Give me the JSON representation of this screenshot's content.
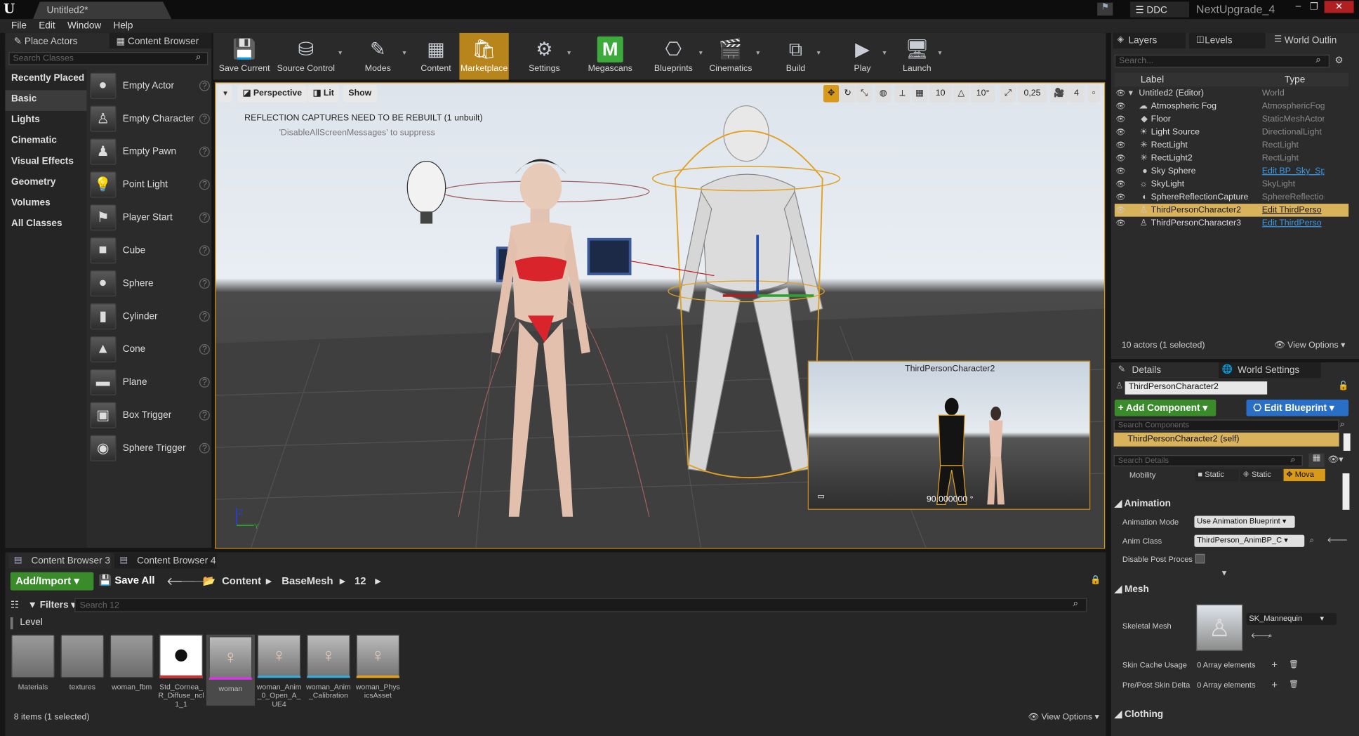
{
  "window": {
    "doc_tab": "Untitled2*",
    "ddc_label": "DDC",
    "project": "NextUpgrade_4"
  },
  "menu": [
    "File",
    "Edit",
    "Window",
    "Help"
  ],
  "place_actors": {
    "tab_label": "Place Actors",
    "content_browser_tab": "Content Browser",
    "search_placeholder": "Search Classes",
    "categories": [
      "Recently Placed",
      "Basic",
      "Lights",
      "Cinematic",
      "Visual Effects",
      "Geometry",
      "Volumes",
      "All Classes"
    ],
    "actors": [
      "Empty Actor",
      "Empty Character",
      "Empty Pawn",
      "Point Light",
      "Player Start",
      "Cube",
      "Sphere",
      "Cylinder",
      "Cone",
      "Plane",
      "Box Trigger",
      "Sphere Trigger"
    ]
  },
  "toolbar": {
    "buttons": [
      "Save Current",
      "Source Control",
      "Modes",
      "Content",
      "Marketplace",
      "Settings",
      "Megascans",
      "Blueprints",
      "Cinematics",
      "Build",
      "Play",
      "Launch"
    ],
    "active": "Marketplace"
  },
  "viewport": {
    "perspective": "Perspective",
    "lit": "Lit",
    "show": "Show",
    "msg_main": "REFLECTION CAPTURES NEED TO BE REBUILT (1 unbuilt)",
    "msg_sub": "'DisableAllScreenMessages' to suppress",
    "grid_snap": "10",
    "rot_snap": "10°",
    "scale_snap": "0,25",
    "cam_speed": "4",
    "pip_title": "ThirdPersonCharacter2",
    "pip_angle": "90.000000 °",
    "axis_z": "Z",
    "axis_y": "Y"
  },
  "content_browser": {
    "tab1": "Content Browser 3",
    "tab2": "Content Browser 4",
    "add_import": "Add/Import",
    "save_all": "Save All",
    "breadcrumbs": [
      "Content",
      "BaseMesh",
      "12"
    ],
    "filters": "Filters",
    "search_placeholder": "Search 12",
    "level_chip": "Level",
    "assets": [
      {
        "label": "Materials",
        "kind": "folder"
      },
      {
        "label": "textures",
        "kind": "folder"
      },
      {
        "label": "woman_fbm",
        "kind": "folder"
      },
      {
        "label": "Std_Cornea_R_Diffuse_ncl1_1",
        "kind": "texture"
      },
      {
        "label": "woman",
        "kind": "mesh"
      },
      {
        "label": "woman_Anim_0_Open_A_UE4",
        "kind": "anim"
      },
      {
        "label": "woman_Anim_Calibration",
        "kind": "anim"
      },
      {
        "label": "woman_PhysicsAsset",
        "kind": "physics"
      }
    ],
    "status": "8 items (1 selected)",
    "view_options": "View Options"
  },
  "outliner": {
    "tabs": [
      "Layers",
      "Levels",
      "World Outlin"
    ],
    "search_placeholder": "Search...",
    "col_label": "Label",
    "col_type": "Type",
    "rows": [
      {
        "label": "Untitled2 (Editor)",
        "type": "World",
        "link": false,
        "selected": false
      },
      {
        "label": "Atmospheric Fog",
        "type": "AtmosphericFog",
        "link": false,
        "selected": false
      },
      {
        "label": "Floor",
        "type": "StaticMeshActor",
        "link": false,
        "selected": false
      },
      {
        "label": "Light Source",
        "type": "DirectionalLight",
        "link": false,
        "selected": false
      },
      {
        "label": "RectLight",
        "type": "RectLight",
        "link": false,
        "selected": false
      },
      {
        "label": "RectLight2",
        "type": "RectLight",
        "link": false,
        "selected": false
      },
      {
        "label": "Sky Sphere",
        "type": "Edit BP_Sky_Sp",
        "link": true,
        "selected": false
      },
      {
        "label": "SkyLight",
        "type": "SkyLight",
        "link": false,
        "selected": false
      },
      {
        "label": "SphereReflectionCapture",
        "type": "SphereReflection",
        "link": false,
        "selected": false
      },
      {
        "label": "ThirdPersonCharacter2",
        "type": "Edit ThirdPerso",
        "link": true,
        "selected": true
      },
      {
        "label": "ThirdPersonCharacter3",
        "type": "Edit ThirdPerso",
        "link": true,
        "selected": false
      }
    ],
    "status": "10 actors (1 selected)",
    "view_options": "View Options"
  },
  "details": {
    "tab": "Details",
    "world_settings_tab": "World Settings",
    "name": "ThirdPersonCharacter2",
    "add_component": "+ Add Component",
    "edit_blueprint": "Edit Blueprint",
    "comp_search": "Search Components",
    "comp_self": "ThirdPersonCharacter2 (self)",
    "details_search": "Search Details",
    "mobility_label": "Mobility",
    "mobility_options": [
      "Static",
      "Static",
      "Mova"
    ],
    "animation_section": "Animation",
    "anim_mode_label": "Animation Mode",
    "anim_mode_value": "Use Animation Blueprint",
    "anim_class_label": "Anim Class",
    "anim_class_value": "ThirdPerson_AnimBP_C",
    "disable_post_label": "Disable Post Proces",
    "mesh_section": "Mesh",
    "skeletal_mesh_label": "Skeletal Mesh",
    "skeletal_mesh_value": "SK_Mannequin",
    "skin_cache_label": "Skin Cache Usage",
    "skin_cache_value": "0 Array elements",
    "prepost_label": "Pre/Post Skin Delta",
    "prepost_value": "0 Array elements",
    "clothing_section": "Clothing"
  }
}
